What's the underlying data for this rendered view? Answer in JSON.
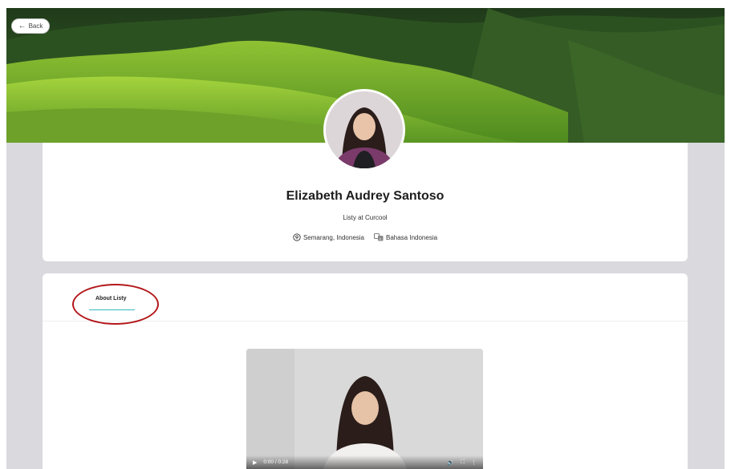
{
  "header": {
    "back_label": "Back"
  },
  "profile": {
    "name": "Elizabeth Audrey Santoso",
    "role": "Listy at Curcool",
    "location": "Semarang, Indonesia",
    "language": "Bahasa Indonesia"
  },
  "tabs": [
    {
      "label": "About Listy",
      "active": true
    }
  ],
  "video": {
    "time": "0:00 / 0:28"
  },
  "colors": {
    "tab_underline": "#35b9bd",
    "highlight_ring": "#b3181b",
    "page_background": "#d9d9de"
  }
}
